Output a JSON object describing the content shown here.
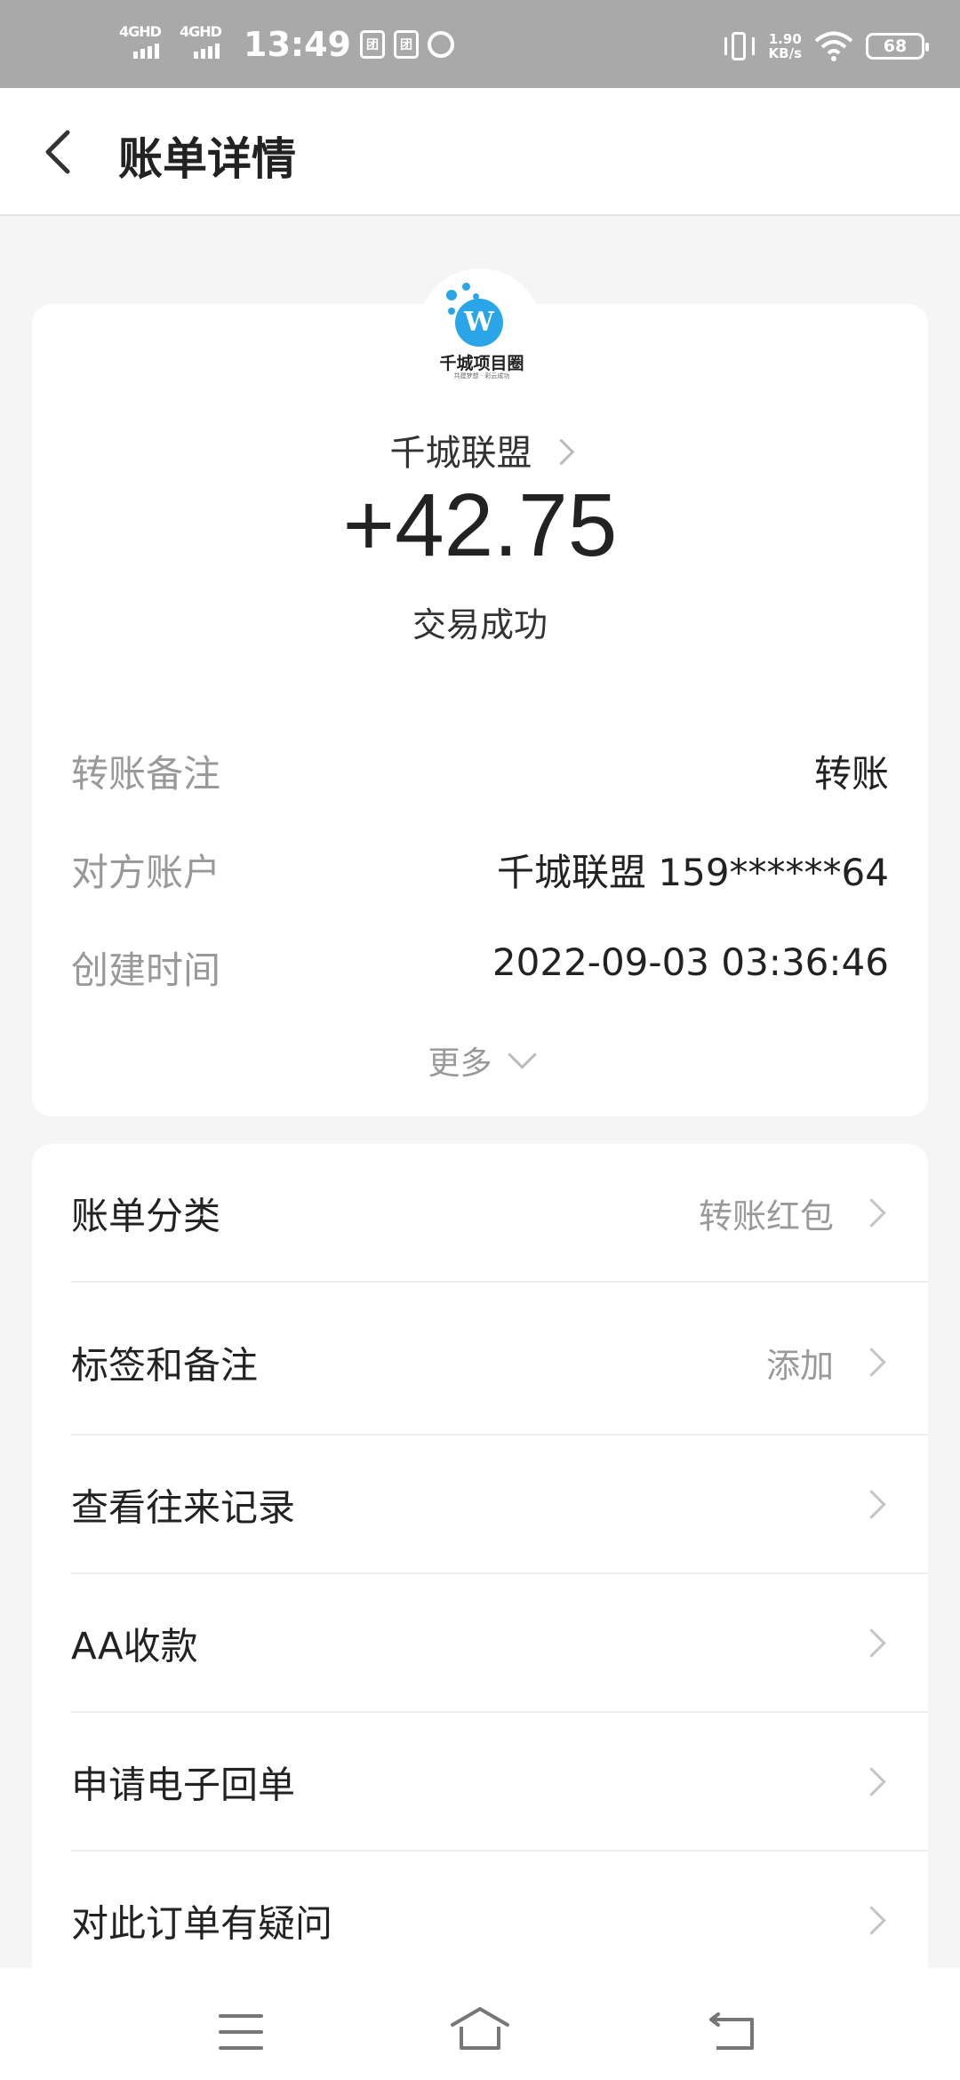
{
  "status_bar": {
    "signal_1": "4GHD",
    "signal_2": "4GHD",
    "time": "13:49",
    "net_speed_value": "1.90",
    "net_speed_unit": "KB/s",
    "battery": "68"
  },
  "header": {
    "title": "账单详情"
  },
  "summary": {
    "logo_text": "千城项目圈",
    "logo_slogan": "共建梦想 · 彩云成功",
    "payee": "千城联盟",
    "amount": "+42.75",
    "status": "交易成功"
  },
  "details": [
    {
      "label": "转账备注",
      "value": "转账"
    },
    {
      "label": "对方账户",
      "value": "千城联盟 159******64"
    },
    {
      "label": "创建时间",
      "value": "2022-09-03 03:36:46"
    }
  ],
  "more_label": "更多",
  "actions": [
    {
      "label": "账单分类",
      "value": "转账红包"
    },
    {
      "label": "标签和备注",
      "value": "添加"
    },
    {
      "label": "查看往来记录",
      "value": ""
    },
    {
      "label": "AA收款",
      "value": ""
    },
    {
      "label": "申请电子回单",
      "value": ""
    },
    {
      "label": "对此订单有疑问",
      "value": ""
    }
  ],
  "colors": {
    "status_bar": "#a9a9a9",
    "logo_blue": "#2aa6e8",
    "background": "#f5f5f5"
  }
}
